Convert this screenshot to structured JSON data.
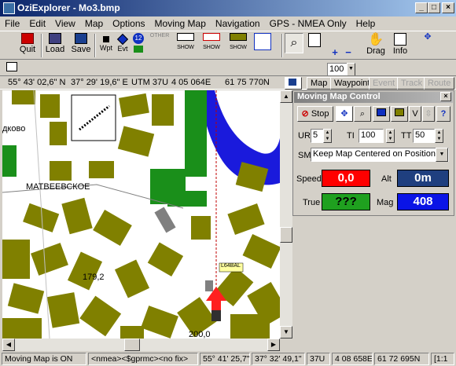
{
  "window": {
    "title": "OziExplorer - Mo3.bmp",
    "min": "_",
    "max": "□",
    "close": "×"
  },
  "menu": [
    "File",
    "Edit",
    "View",
    "Map",
    "Options",
    "Moving Map",
    "Navigation",
    "GPS - NMEA Only",
    "Help"
  ],
  "toolbar": {
    "quit": "Quit",
    "load": "Load",
    "save": "Save",
    "wpt": "Wpt",
    "evt": "Evt",
    "other": "OTHER",
    "show1": "SHOW",
    "show2": "SHOW",
    "show3": "SHOW",
    "zoom": "100",
    "zoom_plus": "+",
    "zoom_minus": "−",
    "drag": "Drag",
    "info": "Info"
  },
  "coords": {
    "lat": "55° 43' 02,6\" N",
    "lon": "37° 29' 19,6\" E",
    "utm": "UTM  37U",
    "east": "4 05 064E",
    "north": "61 75 770N",
    "buttons": {
      "map": "Map",
      "waypoint": "Waypoint",
      "event": "Event",
      "track": "Track",
      "route": "Route"
    }
  },
  "map": {
    "labels": [
      "дково",
      "МАТВЕЕВСКОЕ",
      "179,2",
      "200,0",
      "L64BAL"
    ]
  },
  "mmc": {
    "title": "Moving Map Control",
    "stop": "Stop",
    "v": "V",
    "help": "?",
    "ur_label": "UR",
    "ur_value": "5",
    "ti_label": "TI",
    "ti_value": "100",
    "tt_label": "TT",
    "tt_value": "50",
    "sm_label": "SM",
    "sm_value": "Keep Map Centered on Position",
    "speed_label": "Speed",
    "speed_value": "0,0",
    "alt_label": "Alt",
    "alt_value": "0m",
    "true_label": "True",
    "true_value": "???",
    "mag_label": "Mag",
    "mag_value": "408"
  },
  "status": {
    "mode": "Moving Map is ON",
    "nmea": "<nmea><$gprmc><no fix>",
    "lat": "55° 41' 25,7\" N",
    "lon": "37° 32' 49,1\" E",
    "zone": "37U",
    "east": "4 08 658E",
    "north": "61 72 695N",
    "scale": "[1:1"
  },
  "colors": {
    "speed_bg": "#ff0000",
    "alt_bg": "#1f3f7f",
    "true_bg": "#1fa01f",
    "mag_bg": "#0a14e6"
  }
}
